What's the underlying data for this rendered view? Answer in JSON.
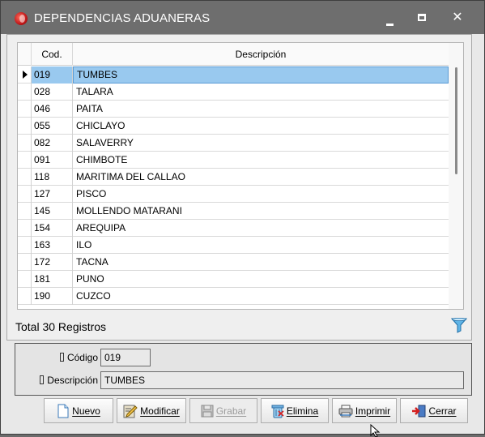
{
  "window": {
    "title": "DEPENDENCIAS ADUANERAS",
    "minimize": "",
    "maximize": "",
    "close": "✕"
  },
  "grid": {
    "columns": {
      "code": "Cod.",
      "description": "Descripción"
    },
    "rows": [
      {
        "code": "019",
        "description": "TUMBES",
        "selected": true
      },
      {
        "code": "028",
        "description": "TALARA"
      },
      {
        "code": "046",
        "description": "PAITA"
      },
      {
        "code": "055",
        "description": "CHICLAYO"
      },
      {
        "code": "082",
        "description": "SALAVERRY"
      },
      {
        "code": "091",
        "description": "CHIMBOTE"
      },
      {
        "code": "118",
        "description": "MARITIMA DEL CALLAO"
      },
      {
        "code": "127",
        "description": "PISCO"
      },
      {
        "code": "145",
        "description": "MOLLENDO MATARANI"
      },
      {
        "code": "154",
        "description": "AREQUIPA"
      },
      {
        "code": "163",
        "description": "ILO"
      },
      {
        "code": "172",
        "description": "TACNA"
      },
      {
        "code": "181",
        "description": "PUNO"
      },
      {
        "code": "190",
        "description": "CUZCO"
      }
    ],
    "total_label": "Total 30 Registros",
    "filter_icon": "filter-icon"
  },
  "detail": {
    "code_label": "Código",
    "code_value": "019",
    "description_label": "Descripción",
    "description_value": "TUMBES"
  },
  "toolbar": {
    "new_label": "Nuevo",
    "modify_label": "Modificar",
    "save_label": "Grabar",
    "delete_label": "Elimina",
    "print_label": "Imprimir",
    "close_label": "Cerrar"
  },
  "colors": {
    "titlebar": "#6e6e6e",
    "selection": "#99c9ef",
    "window_bg": "#e8e8e8"
  }
}
